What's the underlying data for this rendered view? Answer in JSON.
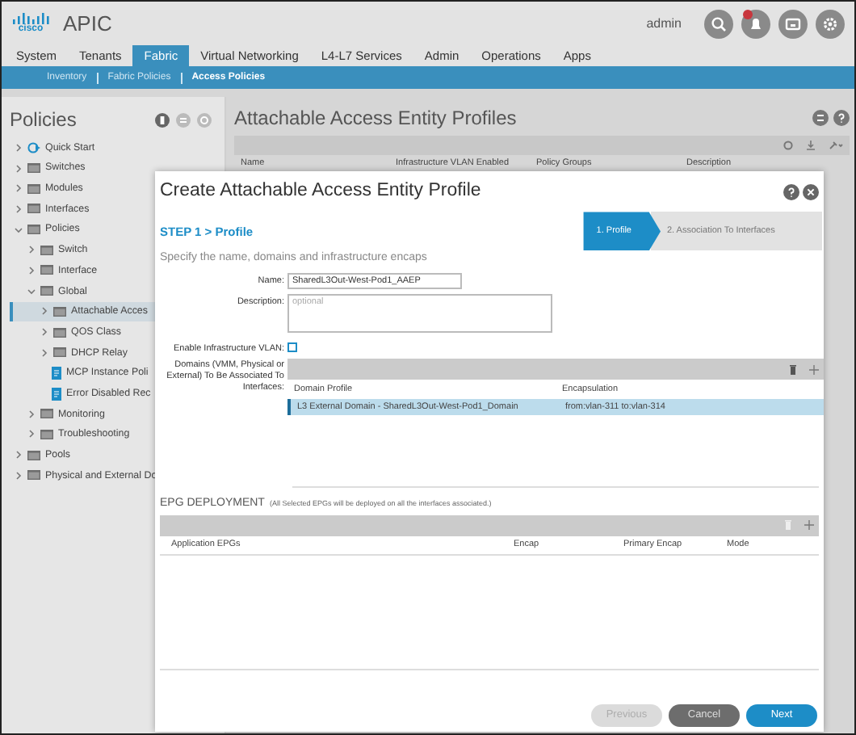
{
  "header": {
    "logo": "cisco",
    "app": "APIC",
    "user": "admin"
  },
  "tabs": [
    {
      "label": "System",
      "selected": false
    },
    {
      "label": "Tenants",
      "selected": false
    },
    {
      "label": "Fabric",
      "selected": true
    },
    {
      "label": "Virtual Networking",
      "selected": false
    },
    {
      "label": "L4-L7 Services",
      "selected": false
    },
    {
      "label": "Admin",
      "selected": false
    },
    {
      "label": "Operations",
      "selected": false
    },
    {
      "label": "Apps",
      "selected": false
    }
  ],
  "subnav": [
    {
      "label": "Inventory",
      "selected": false
    },
    {
      "label": "Fabric Policies",
      "selected": false
    },
    {
      "label": "Access Policies",
      "selected": true
    }
  ],
  "sidebar": {
    "title": "Policies",
    "items": [
      {
        "label": "Quick Start",
        "kind": "start",
        "expanded": false,
        "selected": false
      },
      {
        "label": "Switches",
        "kind": "folder",
        "expanded": false,
        "selected": false
      },
      {
        "label": "Modules",
        "kind": "folder",
        "expanded": false,
        "selected": false
      },
      {
        "label": "Interfaces",
        "kind": "folder",
        "expanded": false,
        "selected": false
      },
      {
        "label": "Policies",
        "kind": "folder",
        "expanded": true,
        "selected": false,
        "children": [
          {
            "label": "Switch",
            "kind": "folder",
            "expanded": false,
            "selected": false
          },
          {
            "label": "Interface",
            "kind": "folder",
            "expanded": false,
            "selected": false
          },
          {
            "label": "Global",
            "kind": "folder",
            "expanded": true,
            "selected": false,
            "children": [
              {
                "label": "Attachable Acces",
                "kind": "folder",
                "expanded": false,
                "selected": true
              },
              {
                "label": "QOS Class",
                "kind": "folder",
                "expanded": false,
                "selected": false
              },
              {
                "label": "DHCP Relay",
                "kind": "folder",
                "expanded": false,
                "selected": false
              },
              {
                "label": "MCP Instance Poli",
                "kind": "doc",
                "selected": false
              },
              {
                "label": "Error Disabled Rec",
                "kind": "doc",
                "selected": false
              }
            ]
          },
          {
            "label": "Monitoring",
            "kind": "folder",
            "expanded": false,
            "selected": false
          },
          {
            "label": "Troubleshooting",
            "kind": "folder",
            "expanded": false,
            "selected": false
          }
        ]
      },
      {
        "label": "Pools",
        "kind": "folder",
        "expanded": false,
        "selected": false
      },
      {
        "label": "Physical and External Do",
        "kind": "folder",
        "expanded": false,
        "selected": false
      }
    ]
  },
  "content": {
    "title": "Attachable Access Entity Profiles",
    "columns": [
      "Name",
      "Infrastructure VLAN Enabled",
      "Policy Groups",
      "Description"
    ]
  },
  "dialog": {
    "title": "Create Attachable Access Entity Profile",
    "steps": [
      {
        "label": "1. Profile",
        "selected": true
      },
      {
        "label": "2. Association To Interfaces",
        "selected": false
      }
    ],
    "step_heading": "STEP 1 > Profile",
    "subtitle": "Specify the name, domains and infrastructure encaps",
    "name": {
      "label": "Name:",
      "value": "SharedL3Out-West-Pod1_AAEP"
    },
    "description": {
      "label": "Description:",
      "placeholder": "optional"
    },
    "infra_vlan": {
      "label": "Enable Infrastructure VLAN:",
      "checked": false
    },
    "domains": {
      "label": "Domains (VMM, Physical or External) To Be Associated To Interfaces:",
      "columns": [
        "Domain Profile",
        "Encapsulation"
      ],
      "rows": [
        {
          "cells": [
            "L3 External Domain - SharedL3Out-West-Pod1_Domain",
            "from:vlan-311 to:vlan-314"
          ],
          "selected": true
        }
      ]
    },
    "epg": {
      "title": "EPG DEPLOYMENT",
      "note": "(All Selected EPGs will be deployed on all the interfaces associated.)",
      "columns": [
        "Application EPGs",
        "Encap",
        "Primary Encap",
        "Mode"
      ]
    },
    "buttons": [
      {
        "label": "Previous",
        "kind": "secondary",
        "disabled": true
      },
      {
        "label": "Cancel",
        "kind": "cancel",
        "disabled": false
      },
      {
        "label": "Next",
        "kind": "primary",
        "disabled": false
      }
    ]
  }
}
